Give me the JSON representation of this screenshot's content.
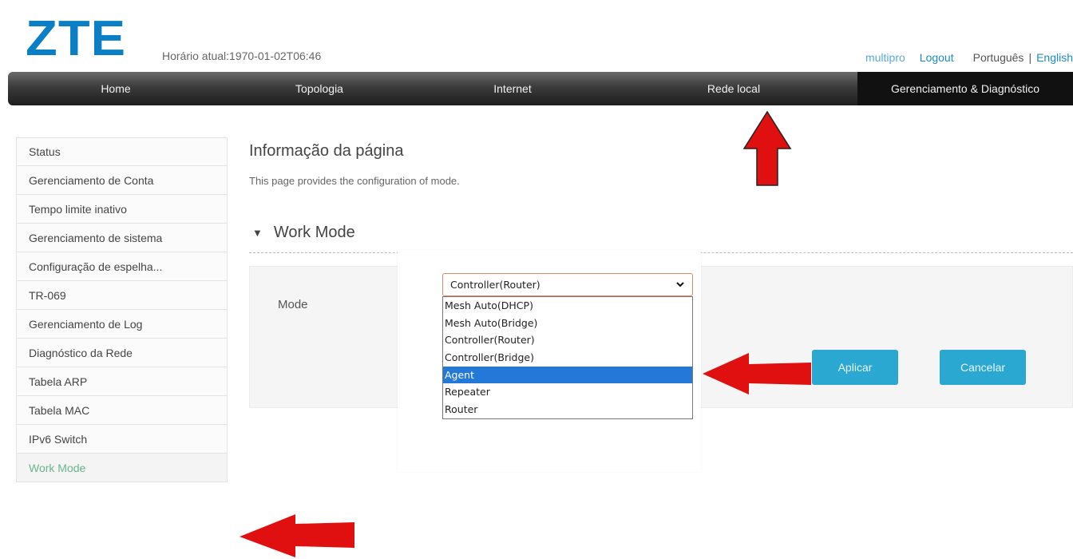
{
  "header": {
    "logo": "ZTE",
    "clock": "Horário atual:1970-01-02T06:46",
    "user": "multipro",
    "logout": "Logout",
    "lang_pt": "Português",
    "lang_sep": "|",
    "lang_en": "English"
  },
  "nav": {
    "items": [
      "Home",
      "Topologia",
      "Internet",
      "Rede local",
      "Gerenciamento & Diagnóstico"
    ],
    "active": "Gerenciamento & Diagnóstico"
  },
  "sidebar": {
    "items": [
      "Status",
      "Gerenciamento de Conta",
      "Tempo limite inativo",
      "Gerenciamento de sistema",
      "Configuração de espelha...",
      "TR-069",
      "Gerenciamento de Log",
      "Diagnóstico da Rede",
      "Tabela ARP",
      "Tabela MAC",
      "IPv6 Switch",
      "Work Mode"
    ],
    "active": "Work Mode"
  },
  "main": {
    "title": "Informação da página",
    "description": "This page provides the configuration of mode.",
    "section_title": "Work Mode",
    "mode_label": "Mode",
    "apply_label": "Aplicar",
    "cancel_label": "Cancelar"
  },
  "mode_select": {
    "selected": "Controller(Router)",
    "options": [
      "Mesh Auto(DHCP)",
      "Mesh Auto(Bridge)",
      "Controller(Router)",
      "Controller(Bridge)",
      "Agent",
      "Repeater",
      "Router"
    ],
    "highlighted": "Agent"
  },
  "colors": {
    "brand": "#0a7fc6",
    "button": "#2ba8d2",
    "highlight": "#2378d8",
    "annotation_arrow": "#e01010"
  }
}
